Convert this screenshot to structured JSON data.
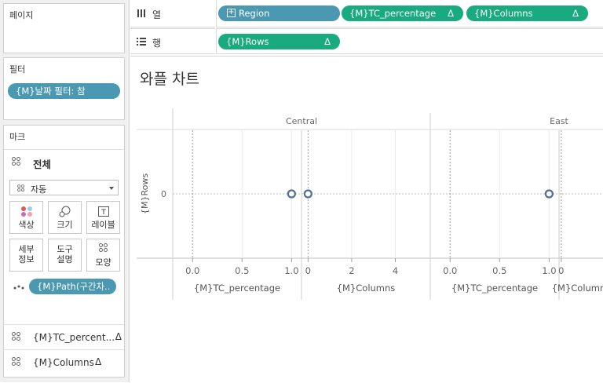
{
  "pages": {
    "title": "페이지"
  },
  "columns_shelf": {
    "label": "열",
    "pills": [
      {
        "label": "Region",
        "kind": "dimension",
        "delta": ""
      },
      {
        "label": "{M}TC_percentage",
        "kind": "measure",
        "delta": "Δ"
      },
      {
        "label": "{M}Columns",
        "kind": "measure",
        "delta": "Δ"
      }
    ]
  },
  "rows_shelf": {
    "label": "행",
    "pills": [
      {
        "label": "{M}Rows",
        "kind": "measure",
        "delta": "Δ"
      }
    ]
  },
  "filters": {
    "title": "필터",
    "pill": "{M}날짜 필터: 참"
  },
  "marks": {
    "title": "마크",
    "all_label": "전체",
    "mark_type": "자동",
    "buttons": [
      {
        "label": "색상",
        "icon": "color-icon"
      },
      {
        "label": "크기",
        "icon": "size-icon"
      },
      {
        "label": "레이블",
        "icon": "label-icon"
      },
      {
        "label": "세부\n정보",
        "icon": "detail-icon"
      },
      {
        "label": "도구\n설명",
        "icon": "tooltip-icon"
      },
      {
        "label": "모양",
        "icon": "shape-icon"
      }
    ],
    "path_pill": "{M}Path(구간차..",
    "fields": [
      {
        "label": "{M}TC_percent...",
        "delta": "Δ"
      },
      {
        "label": "{M}Columns",
        "delta": "Δ"
      }
    ]
  },
  "view": {
    "title": "와플 차트"
  },
  "colors": {
    "dimension_pill": "#4a98b1",
    "measure_pill": "#1aaa7f",
    "mark": "#4e6f9a"
  },
  "chart_data": {
    "type": "scatter",
    "y_axis_title": "{M}Rows",
    "y_ticks": [
      "0"
    ],
    "panes": [
      {
        "region": "Central",
        "axes": [
          {
            "title": "{M}TC_percentage",
            "ticks": [
              "0.0",
              "0.5",
              "1.0"
            ],
            "range": [
              -0.2,
              1.1
            ],
            "points": [
              {
                "x": 1.0,
                "y": 0
              }
            ]
          },
          {
            "title": "{M}Columns",
            "ticks": [
              "0",
              "2",
              "4"
            ],
            "range": [
              -0.3,
              5.6
            ],
            "points": [
              {
                "x": 0,
                "y": 0
              }
            ]
          }
        ]
      },
      {
        "region": "East",
        "axes": [
          {
            "title": "{M}TC_percentage",
            "ticks": [
              "0.0",
              "0.5",
              "1.0"
            ],
            "range": [
              -0.2,
              1.1
            ],
            "points": [
              {
                "x": 1.0,
                "y": 0
              }
            ]
          },
          {
            "title": "{M}Columns",
            "ticks": [
              "0"
            ],
            "range": [
              -0.3,
              5.6
            ],
            "points": []
          }
        ]
      }
    ]
  }
}
